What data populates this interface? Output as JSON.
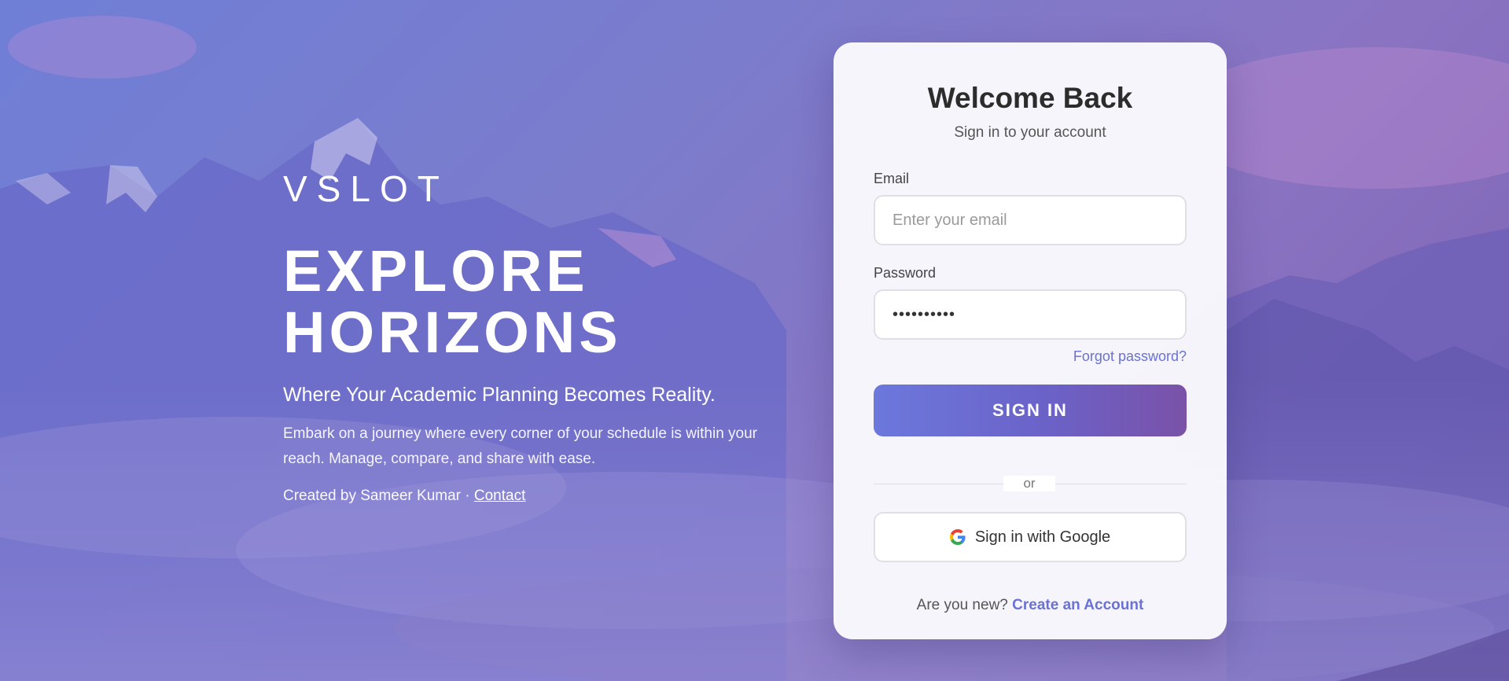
{
  "hero": {
    "brand": "VSLOT",
    "headline_line1": "EXPLORE",
    "headline_line2": "HORIZONS",
    "tagline": "Where Your Academic Planning Becomes Reality.",
    "description": "Embark on a journey where every corner of your schedule is within your reach. Manage, compare, and share with ease.",
    "credit_prefix": "Created by Sameer Kumar · ",
    "contact_link": "Contact"
  },
  "login": {
    "title": "Welcome Back",
    "subtitle": "Sign in to your account",
    "email_label": "Email",
    "email_placeholder": "Enter your email",
    "email_value": "",
    "password_label": "Password",
    "password_value": "••••••••••",
    "forgot_password": "Forgot password?",
    "sign_in_button": "SIGN IN",
    "divider_text": "or",
    "google_button": "Sign in with Google",
    "signup_prompt": "Are you new? ",
    "signup_link": "Create an Account"
  },
  "colors": {
    "accent": "#6a72d4",
    "button_gradient_start": "#6c78dc",
    "button_gradient_end": "#7a52a8",
    "background_start": "#6f7fd6",
    "background_end": "#7a5fb0"
  },
  "icons": {
    "google": "google-g-icon"
  }
}
